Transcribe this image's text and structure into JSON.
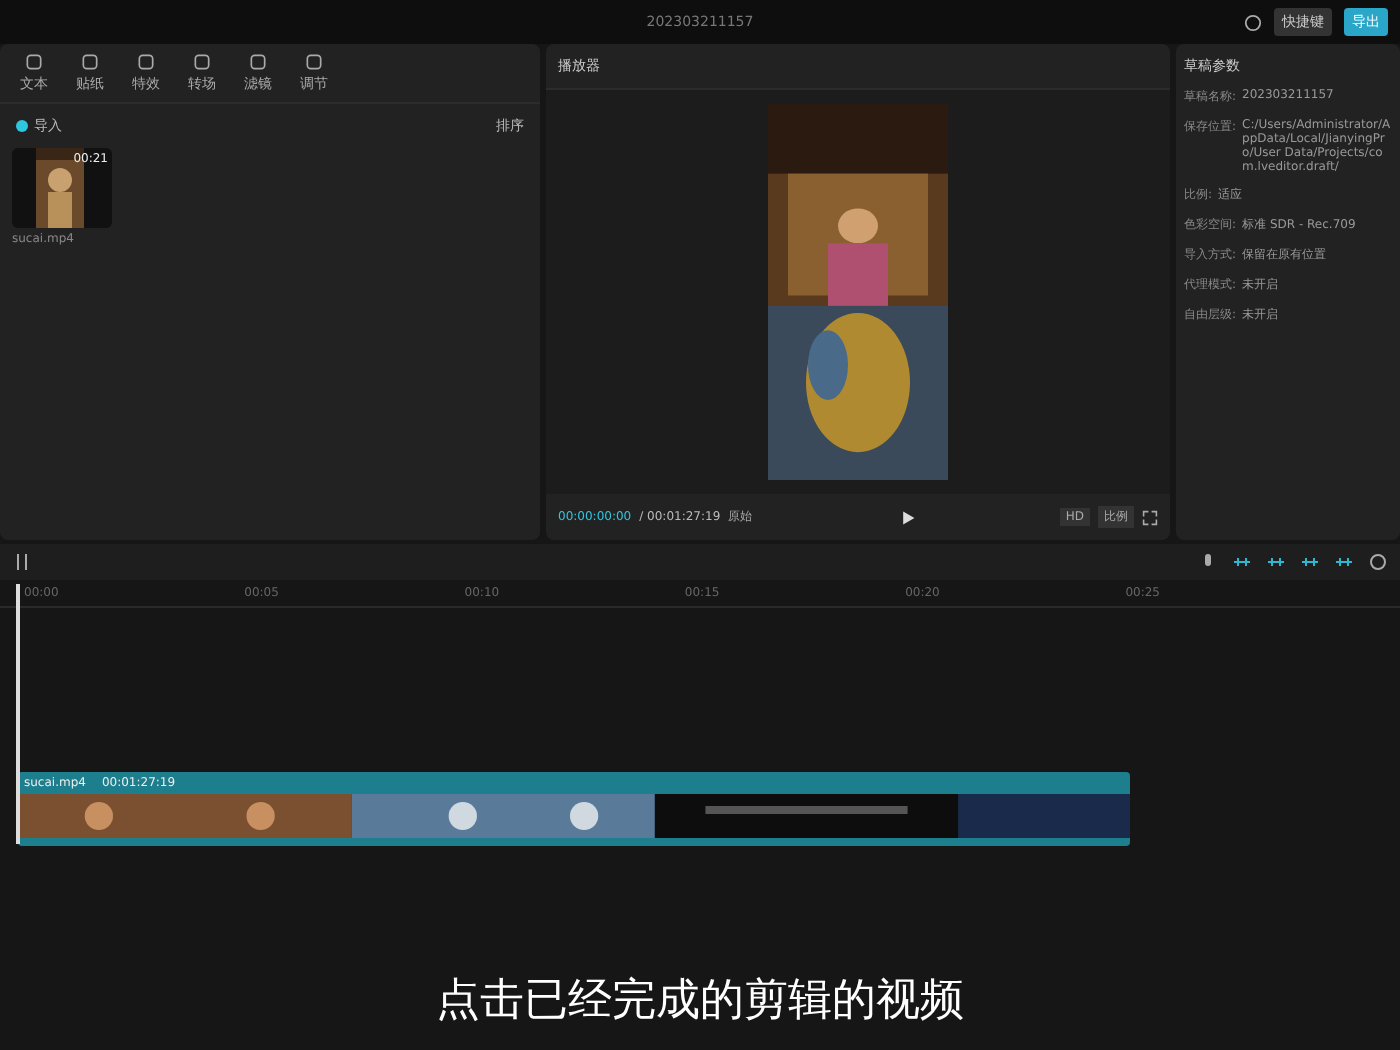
{
  "window": {
    "title": "202303211157"
  },
  "top_actions": [
    {
      "label": "快捷键",
      "kind": "plain"
    },
    {
      "label": "导出",
      "kind": "primary"
    }
  ],
  "media_tabs": [
    {
      "label": "文本",
      "selected": false
    },
    {
      "label": "贴纸",
      "selected": false
    },
    {
      "label": "特效",
      "selected": false
    },
    {
      "label": "转场",
      "selected": false
    },
    {
      "label": "滤镜",
      "selected": false
    },
    {
      "label": "调节",
      "selected": false
    }
  ],
  "media": {
    "import_label": "导入",
    "sort_label": "排序",
    "clips": [
      {
        "duration": "00:21",
        "name": "sucai.mp4"
      }
    ]
  },
  "player": {
    "title": "播放器",
    "current_time": "00:00:00:00",
    "total_time": "/ 00:01:27:19",
    "ratio_label": "原始",
    "buttons": [
      "HD",
      "比例"
    ]
  },
  "draft": {
    "title": "草稿参数",
    "fields": [
      {
        "label": "草稿名称:",
        "value": "202303211157"
      },
      {
        "label": "保存位置:",
        "value": "C:/Users/Administrator/AppData/Local/JianyingPro/User Data/Projects/com.lveditor.draft/"
      },
      {
        "label": "比例:",
        "value": "适应"
      },
      {
        "label": "色彩空间:",
        "value": "标准 SDR - Rec.709"
      },
      {
        "label": "导入方式:",
        "value": "保留在原有位置"
      },
      {
        "label": "代理模式:",
        "value": "未开启"
      },
      {
        "label": "自由层级:",
        "value": "未开启"
      }
    ]
  },
  "timeline": {
    "ticks": [
      "00:00",
      "00:05",
      "00:10",
      "00:15",
      "00:20",
      "00:25"
    ],
    "clip": {
      "name": "sucai.mp4",
      "duration": "00:01:27:19"
    }
  },
  "caption": "点击已经完成的剪辑的视频"
}
